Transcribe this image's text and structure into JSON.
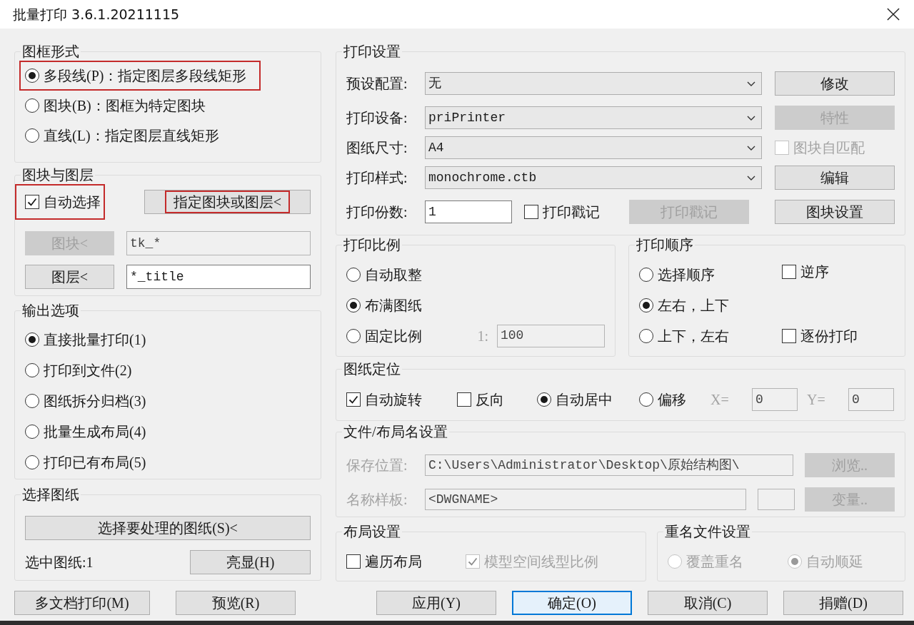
{
  "window": {
    "title": "批量打印 3.6.1.20211115"
  },
  "frame_type": {
    "title": "图框形式",
    "options": [
      {
        "label": "多段线(P)：指定图层多段线矩形",
        "selected": true,
        "highlighted": true
      },
      {
        "label": "图块(B)：图框为特定图块",
        "selected": false,
        "highlighted": false
      },
      {
        "label": "直线(L)：指定图层直线矩形",
        "selected": false,
        "highlighted": false
      }
    ]
  },
  "blocks_layers": {
    "title": "图块与图层",
    "auto_select": {
      "label": "自动选择",
      "checked": true,
      "highlighted": true
    },
    "pick_button": {
      "label": "指定图块或图层<",
      "highlighted": true
    },
    "filters": [
      {
        "button": "图块<",
        "value": "tk_*",
        "disabled": true
      },
      {
        "button": "图层<",
        "value": "*_title",
        "disabled": false
      }
    ]
  },
  "output_options": {
    "title": "输出选项",
    "options": [
      {
        "label": "直接批量打印(1)",
        "selected": true
      },
      {
        "label": "打印到文件(2)",
        "selected": false
      },
      {
        "label": "图纸拆分归档(3)",
        "selected": false
      },
      {
        "label": "批量生成布局(4)",
        "selected": false
      },
      {
        "label": "打印已有布局(5)",
        "selected": false
      }
    ]
  },
  "select_drawings": {
    "title": "选择图纸",
    "select_button": "选择要处理的图纸(S)<",
    "selected_count": "选中图纸:1",
    "highlight_button": "亮显(H)"
  },
  "left_buttons": [
    {
      "label": "多文档打印(M)"
    },
    {
      "label": "预览(R)"
    }
  ],
  "print_settings": {
    "title": "打印设置",
    "rows": [
      {
        "label": "预设配置:",
        "value": "无",
        "side": {
          "kind": "button",
          "label": "修改",
          "disabled": false
        }
      },
      {
        "label": "打印设备:",
        "value": "priPrinter",
        "side": {
          "kind": "button",
          "label": "特性",
          "disabled": true
        }
      },
      {
        "label": "图纸尺寸:",
        "value": "A4",
        "side": {
          "kind": "checkbox",
          "label": "图块自匹配",
          "checked": false,
          "disabled": true
        }
      },
      {
        "label": "打印样式:",
        "value": "monochrome.ctb",
        "side": {
          "kind": "button",
          "label": "编辑",
          "disabled": false
        }
      }
    ],
    "copies": {
      "label": "打印份数:",
      "value": "1"
    },
    "stamp_checkbox": {
      "label": "打印戳记",
      "checked": false
    },
    "stamp_button": {
      "label": "打印戳记",
      "disabled": true
    },
    "block_settings_button": {
      "label": "图块设置",
      "disabled": false
    }
  },
  "print_scale": {
    "title": "打印比例",
    "options": [
      {
        "label": "自动取整",
        "selected": false
      },
      {
        "label": "布满图纸",
        "selected": true
      },
      {
        "label": "固定比例",
        "selected": false
      }
    ],
    "ratio": {
      "label": "1:",
      "value": "100",
      "disabled": true
    }
  },
  "print_order": {
    "title": "打印顺序",
    "options": [
      {
        "label": "选择顺序",
        "selected": false
      },
      {
        "label": "左右，上下",
        "selected": true
      },
      {
        "label": "上下，左右",
        "selected": false
      }
    ],
    "reverse": {
      "label": "逆序",
      "checked": false
    },
    "collate": {
      "label": "逐份打印",
      "checked": false
    }
  },
  "paper_position": {
    "title": "图纸定位",
    "auto_rotate": {
      "label": "自动旋转",
      "checked": true
    },
    "flip": {
      "label": "反向",
      "checked": false
    },
    "placement": [
      {
        "label": "自动居中",
        "selected": true
      },
      {
        "label": "偏移",
        "selected": false
      }
    ],
    "offset": {
      "disabled": true,
      "x_label": "X=",
      "x_value": "0",
      "y_label": "Y=",
      "y_value": "0"
    }
  },
  "file_naming": {
    "title": "文件/布局名设置",
    "disabled": true,
    "save_location": {
      "label": "保存位置:",
      "value": "C:\\Users\\Administrator\\Desktop\\原始结构图\\",
      "button": "浏览.."
    },
    "name_template": {
      "label": "名称样板:",
      "value": "<DWGNAME>",
      "button": "变量.."
    }
  },
  "layout_settings": {
    "title": "布局设置",
    "traverse": {
      "label": "遍历布局",
      "checked": false,
      "disabled": false
    },
    "linetype_scale": {
      "label": "模型空间线型比例",
      "checked": true,
      "disabled": true
    }
  },
  "duplicate_names": {
    "title": "重名文件设置",
    "disabled": true,
    "options": [
      {
        "label": "覆盖重名",
        "selected": false
      },
      {
        "label": "自动顺延",
        "selected": true
      }
    ]
  },
  "dialog_buttons": [
    {
      "label": "应用(Y)",
      "default": false
    },
    {
      "label": "确定(O)",
      "default": true
    },
    {
      "label": "取消(C)",
      "default": false
    },
    {
      "label": "捐赠(D)",
      "default": false
    }
  ]
}
